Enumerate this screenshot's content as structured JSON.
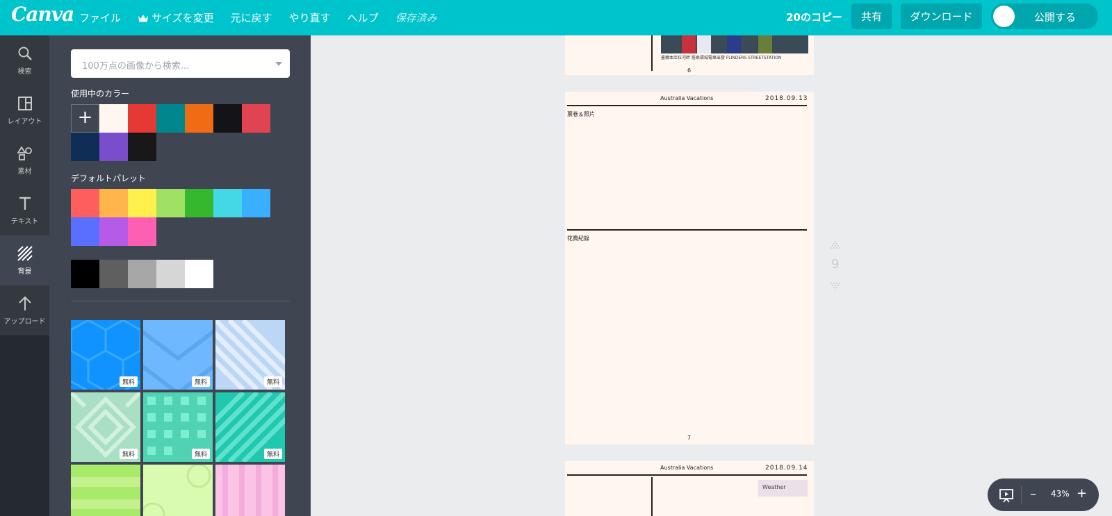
{
  "app": {
    "logo": "Canva"
  },
  "menu": {
    "file": "ファイル",
    "resize": "サイズを変更",
    "undo": "元に戻す",
    "redo": "やり直す",
    "help": "ヘルプ",
    "saved": "保存済み"
  },
  "header": {
    "doc_title": "20のコピー",
    "share": "共有",
    "download": "ダウンロード",
    "publish": "公開する"
  },
  "rail": {
    "search": "検索",
    "layout": "レイアウト",
    "elements": "素材",
    "text": "テキスト",
    "background": "背景",
    "upload": "アップロード"
  },
  "panel": {
    "search_placeholder": "100万点の画像から検索...",
    "used_colors_title": "使用中のカラー",
    "add_color": "+",
    "used_colors": [
      "#fff6f0",
      "#e53935",
      "#00878d",
      "#f06c14",
      "#141317",
      "#e04450",
      "#0f2d55",
      "#7a4dcc",
      "#181818"
    ],
    "default_palette_title": "デフォルトパレット",
    "default_palette": [
      "#ff5e5e",
      "#ffb54c",
      "#fff14d",
      "#9fe065",
      "#35b82d",
      "#44d8e5",
      "#3aaeff",
      "#5a6eff",
      "#b65ae8",
      "#ff5fb3"
    ],
    "grays": [
      "#000000",
      "#5f5f5f",
      "#a7a7a7",
      "#d6d6d6",
      "#ffffff"
    ],
    "free_badge": "無料"
  },
  "canvas": {
    "page6": {
      "caption": "墨爾本亞拉河畔 搭乘環城電車出發 FLINDERS STREETSTATION",
      "number": "6"
    },
    "page7": {
      "header": "Australia Vacations",
      "date": "2018.09.13",
      "section1": "票卷＆照片",
      "section2": "花費紀錄",
      "number": "7"
    },
    "page8": {
      "header": "Australia Vacations",
      "date": "2018.09.14",
      "weather": "Weather"
    },
    "current_page": "9"
  },
  "zoom": {
    "minus": "–",
    "level": "43%",
    "plus": "+"
  }
}
